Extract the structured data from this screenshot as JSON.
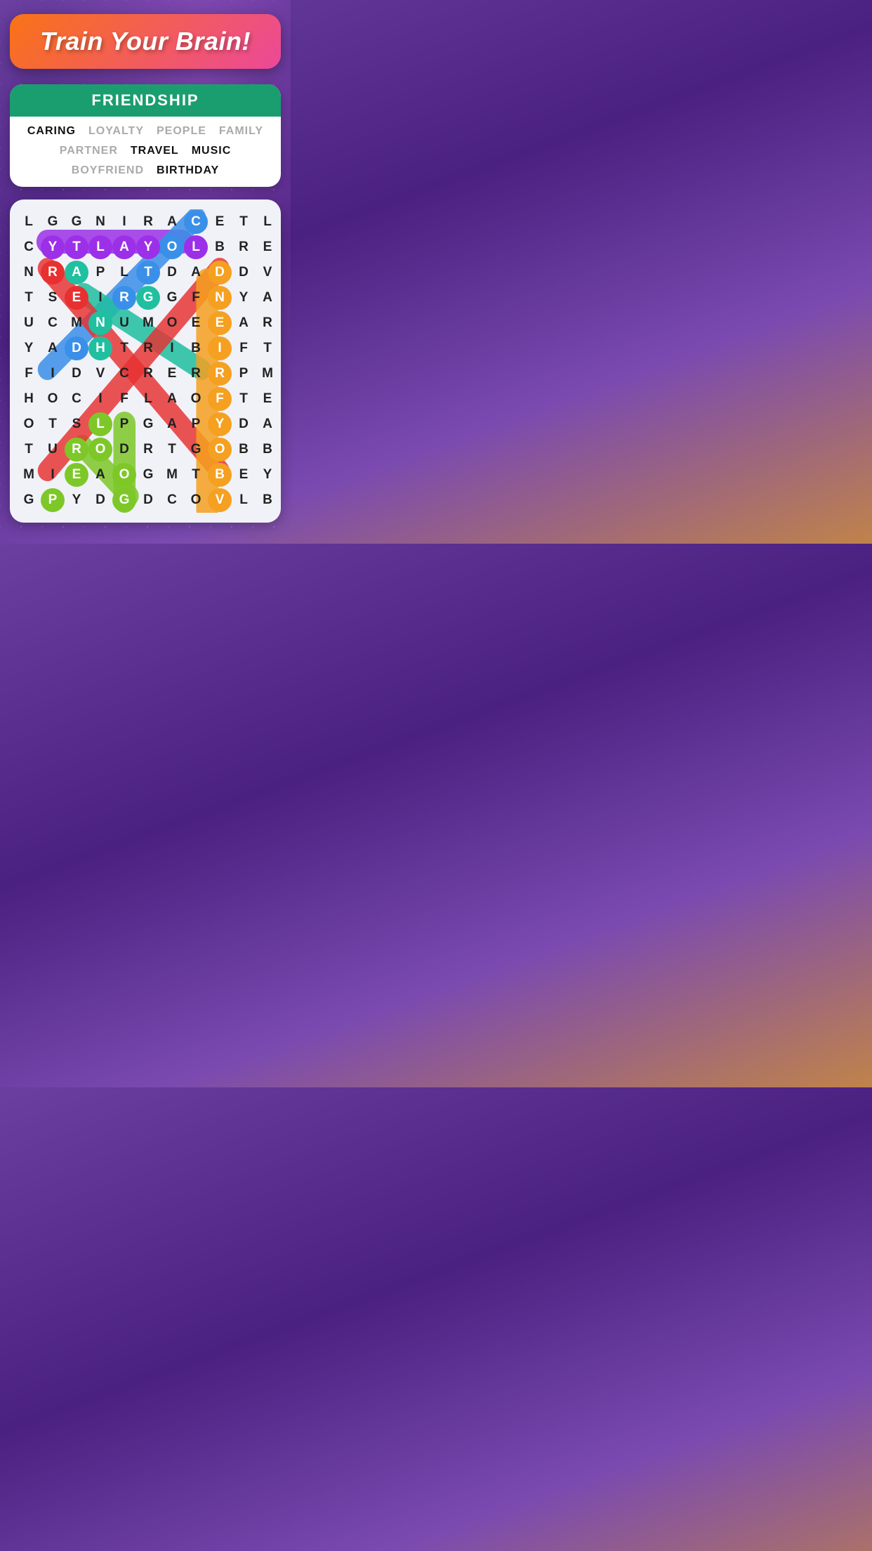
{
  "banner": {
    "title": "Train Your Brain!"
  },
  "theme": {
    "header": "FRIENDSHIP",
    "words": [
      {
        "text": "CARING",
        "found": true
      },
      {
        "text": "LOYALTY",
        "found": false
      },
      {
        "text": "PEOPLE",
        "found": false
      },
      {
        "text": "FAMILY",
        "found": false
      },
      {
        "text": "PARTNER",
        "found": false
      },
      {
        "text": "TRAVEL",
        "found": true
      },
      {
        "text": "MUSIC",
        "found": true
      },
      {
        "text": "BOYFRIEND",
        "found": false
      },
      {
        "text": "BIRTHDAY",
        "found": true
      }
    ]
  },
  "grid": {
    "rows": [
      [
        "L",
        "G",
        "G",
        "N",
        "I",
        "R",
        "A",
        "C",
        "E",
        "T",
        "L"
      ],
      [
        "C",
        "Y",
        "T",
        "L",
        "A",
        "Y",
        "O",
        "L",
        "B",
        "R",
        "E"
      ],
      [
        "N",
        "R",
        "A",
        "P",
        "L",
        "T",
        "D",
        "A",
        "D",
        "D",
        "V"
      ],
      [
        "T",
        "S",
        "E",
        "I",
        "R",
        "G",
        "G",
        "F",
        "N",
        "Y",
        "A"
      ],
      [
        "U",
        "C",
        "M",
        "N",
        "U",
        "M",
        "O",
        "E",
        "E",
        "A",
        "R"
      ],
      [
        "Y",
        "A",
        "D",
        "H",
        "T",
        "R",
        "I",
        "B",
        "I",
        "F",
        "T"
      ],
      [
        "F",
        "I",
        "D",
        "V",
        "C",
        "R",
        "E",
        "R",
        "R",
        "P",
        "M"
      ],
      [
        "H",
        "O",
        "C",
        "I",
        "F",
        "L",
        "A",
        "O",
        "F",
        "T",
        "E"
      ],
      [
        "O",
        "T",
        "S",
        "L",
        "P",
        "G",
        "A",
        "P",
        "Y",
        "D",
        "A"
      ],
      [
        "T",
        "U",
        "R",
        "O",
        "D",
        "R",
        "T",
        "G",
        "O",
        "B",
        "B"
      ],
      [
        "M",
        "I",
        "E",
        "A",
        "O",
        "G",
        "M",
        "T",
        "B",
        "E",
        "Y"
      ],
      [
        "G",
        "P",
        "Y",
        "D",
        "G",
        "D",
        "C",
        "O",
        "V",
        "L",
        "B"
      ]
    ]
  },
  "colors": {
    "purple": "#9b30e8",
    "blue": "#3a8fe8",
    "teal": "#20bfa0",
    "green": "#7dc828",
    "red": "#e83030",
    "orange": "#f5a020",
    "banner_start": "#f97316",
    "banner_end": "#ec4899",
    "theme_bg": "#1a9e70"
  }
}
